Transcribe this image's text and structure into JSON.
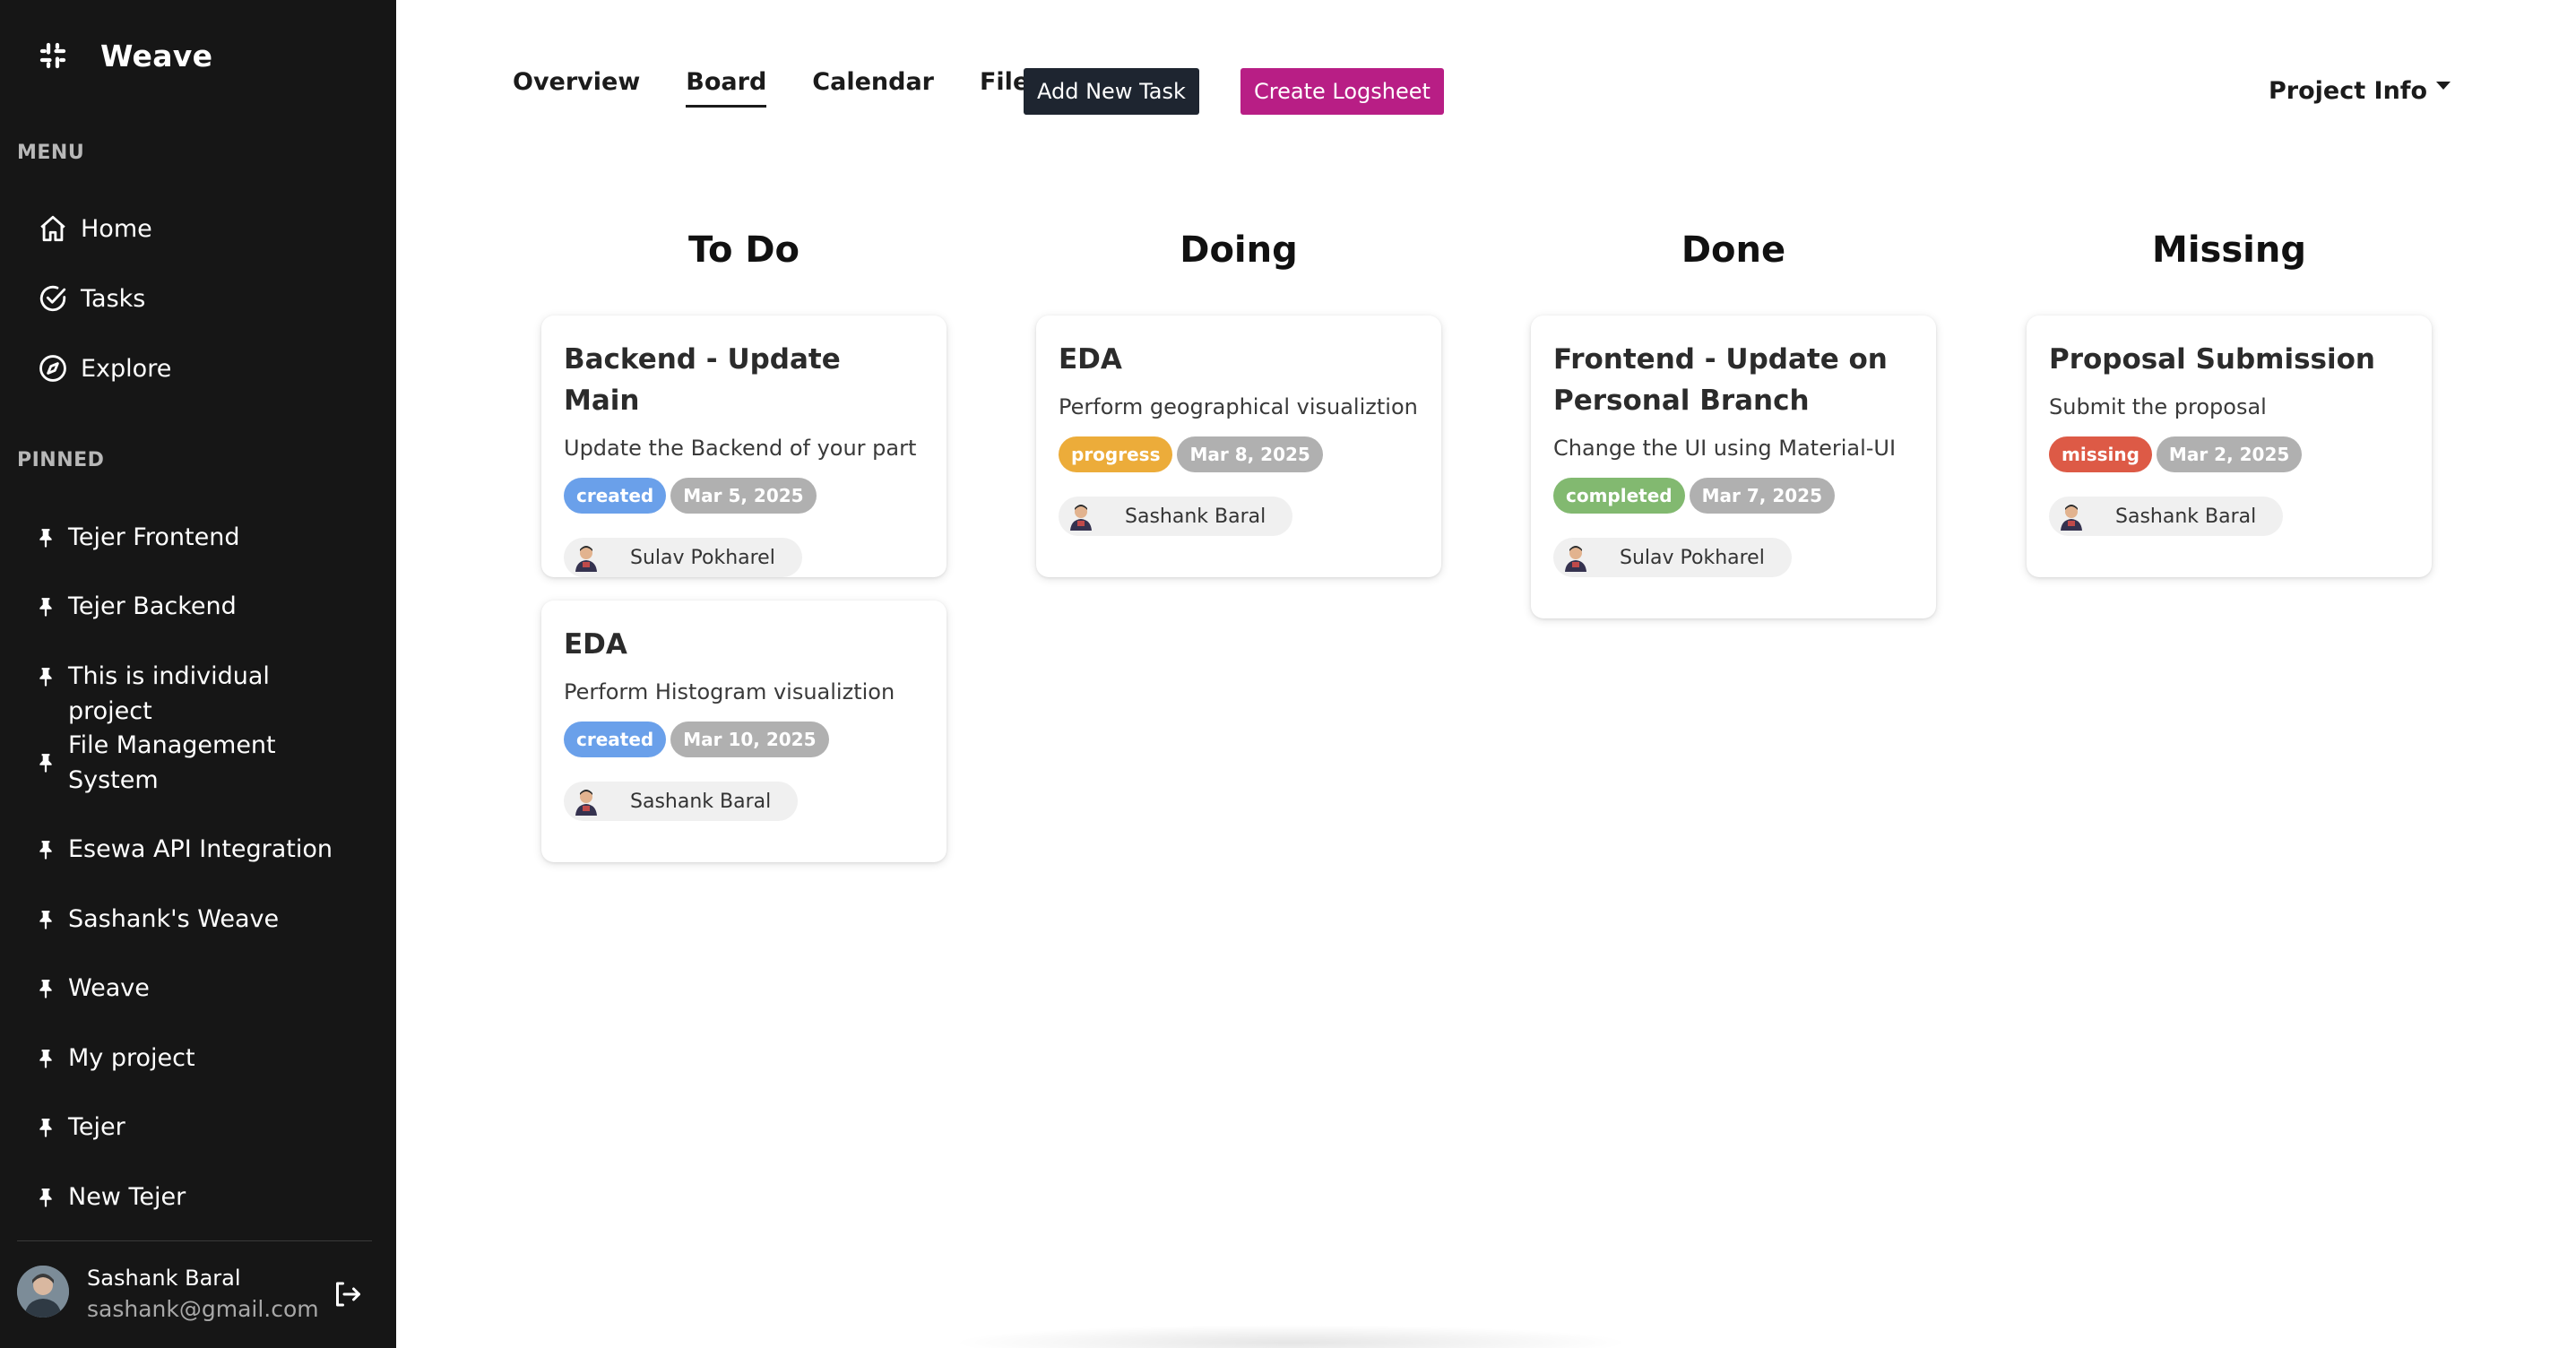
{
  "sidebar": {
    "brand": "Weave",
    "menu_label": "MENU",
    "menu": [
      {
        "label": "Home",
        "icon": "home-icon"
      },
      {
        "label": "Tasks",
        "icon": "check-circle-icon"
      },
      {
        "label": "Explore",
        "icon": "compass-icon"
      }
    ],
    "pinned_label": "PINNED",
    "pinned": [
      {
        "label": "Tejer Frontend"
      },
      {
        "label": "Tejer Backend"
      },
      {
        "label": "This is individual project"
      },
      {
        "label": "File Management System"
      },
      {
        "label": "Esewa API Integration"
      },
      {
        "label": "Sashank's Weave"
      },
      {
        "label": "Weave"
      },
      {
        "label": "My project"
      },
      {
        "label": "Tejer"
      },
      {
        "label": "New Tejer"
      }
    ],
    "user": {
      "name": "Sashank Baral",
      "email": "sashank@gmail.com"
    }
  },
  "header": {
    "tabs": [
      {
        "label": "Overview",
        "active": false
      },
      {
        "label": "Board",
        "active": true
      },
      {
        "label": "Calendar",
        "active": false
      },
      {
        "label": "File",
        "active": false
      }
    ],
    "add_task_label": "Add New Task",
    "create_logsheet_label": "Create Logsheet",
    "project_info_label": "Project Info"
  },
  "colors": {
    "sidebar_bg": "#161616",
    "created": "#6aa0ea",
    "progress": "#ecac3a",
    "completed": "#82b970",
    "missing": "#dd5a46",
    "date": "#b0b0b0",
    "logsheet_button": "#b81e85",
    "add_task_button": "#1e2530"
  },
  "board": {
    "columns": [
      {
        "title": "To Do",
        "cards": [
          {
            "title": "Backend - Update Main",
            "description": "Update the Backend of your part",
            "status": "created",
            "date": "Mar 5, 2025",
            "assignee": "Sulav Pokharel"
          },
          {
            "title": "EDA",
            "description": "Perform Histogram visualiztion",
            "status": "created",
            "date": "Mar 10, 2025",
            "assignee": "Sashank Baral"
          }
        ]
      },
      {
        "title": "Doing",
        "cards": [
          {
            "title": "EDA",
            "description": "Perform geographical visualiztion",
            "status": "progress",
            "date": "Mar 8, 2025",
            "assignee": "Sashank Baral"
          }
        ]
      },
      {
        "title": "Done",
        "cards": [
          {
            "title": "Frontend - Update on Personal Branch",
            "description": "Change the UI using Material-UI",
            "status": "completed",
            "date": "Mar 7, 2025",
            "assignee": "Sulav Pokharel"
          }
        ]
      },
      {
        "title": "Missing",
        "cards": [
          {
            "title": "Proposal Submission",
            "description": "Submit the proposal",
            "status": "missing",
            "date": "Mar 2, 2025",
            "assignee": "Sashank Baral"
          }
        ]
      }
    ]
  }
}
